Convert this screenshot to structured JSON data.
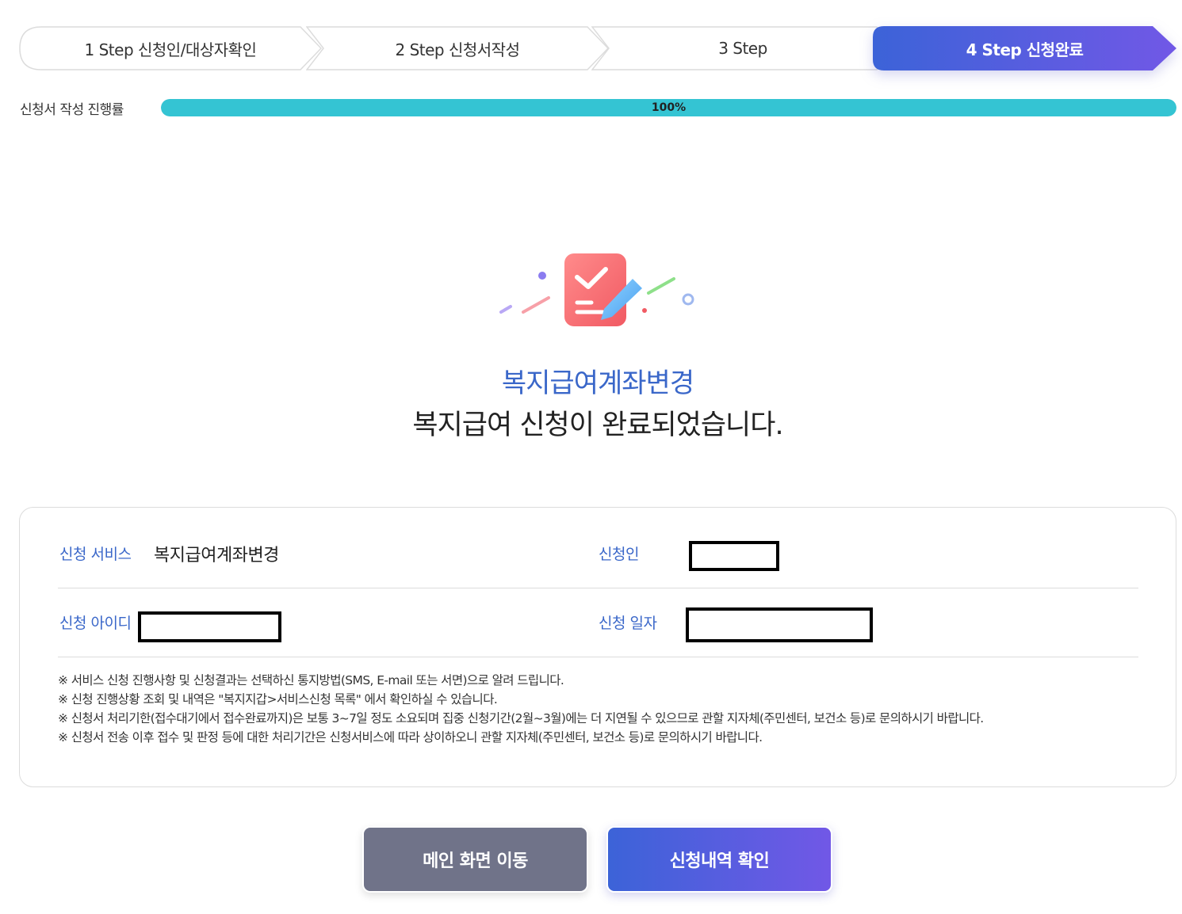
{
  "steps": [
    {
      "label": "1 Step 신청인/대상자확인",
      "active": false
    },
    {
      "label": "2 Step 신청서작성",
      "active": false
    },
    {
      "label": "3 Step",
      "active": false
    },
    {
      "label": "4 Step 신청완료",
      "active": true
    }
  ],
  "progress": {
    "label": "신청서 작성 진행률",
    "value_text": "100%",
    "fraction": 1.0,
    "fill_color": "#34c4d3"
  },
  "hero": {
    "icon": "document-check-icon",
    "service_title": "복지급여계좌변경",
    "message": "복지급여 신청이 완료되었습니다."
  },
  "info": {
    "service_label": "신청 서비스",
    "service_value": "복지급여계좌변경",
    "applicant_label": "신청인",
    "applicant_value": "",
    "id_label": "신청 아이디",
    "id_value": "",
    "date_label": "신청 일자",
    "date_value": ""
  },
  "notes": [
    "※ 서비스 신청 진행사항 및 신청결과는 선택하신 통지방법(SMS, E-mail 또는 서면)으로 알려 드립니다.",
    "※ 신청 진행상황 조회 및 내역은 \"복지지갑>서비스신청 목록\" 에서 확인하실 수 있습니다.",
    "※ 신청서 처리기한(접수대기에서 접수완료까지)은 보통 3~7일 정도 소요되며 집중 신청기간(2월~3월)에는 더 지연될 수 있으므로 관할 지자체(주민센터, 보건소 등)로 문의하시기 바랍니다.",
    "※ 신청서 전송 이후 접수 및 판정 등에 대한 처리기간은 신청서비스에 따라 상이하오니 관할 지자체(주민센터, 보건소 등)로 문의하시기 바랍니다."
  ],
  "buttons": {
    "main": "메인 화면 이동",
    "history": "신청내역 확인"
  },
  "colors": {
    "accent_blue": "#3a67c9",
    "active_step_start": "#3c63d8",
    "active_step_end": "#7158e6",
    "main_button": "#707389"
  }
}
